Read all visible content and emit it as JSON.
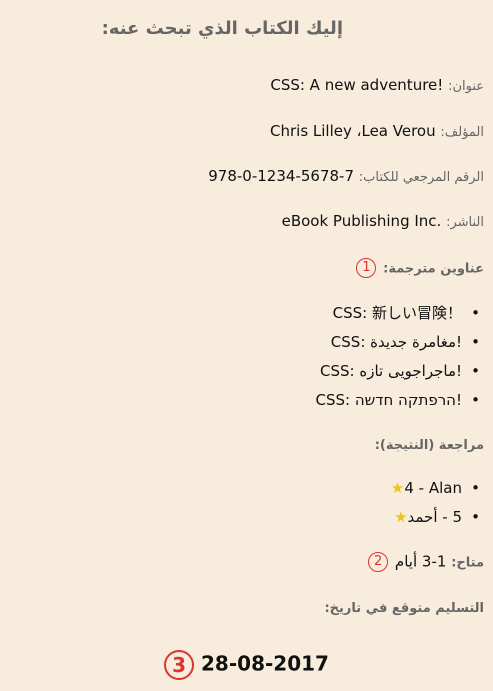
{
  "title": "إليك الكتاب الذي تبحث عنه:",
  "fields": {
    "book_title_label": "عنوان:",
    "book_title_value": "CSS: A new adventure!",
    "author_label": "المؤلف:",
    "author_value": "Chris Lilley ،Lea Verou",
    "isbn_label": "الرقم المرجعي للكتاب:",
    "isbn_value": "978-0-1234-5678-7",
    "publisher_label": "الناشر:",
    "publisher_value": "eBook Publishing Inc."
  },
  "translated": {
    "label": "عناوين مترجمة:",
    "marker": "1",
    "items": [
      "CSS: 新しい冒険！",
      "CSS: مغامرة جديدة!",
      "CSS: ماجراجویی تازه!",
      "CSS: הרפתקה חדשה!"
    ]
  },
  "reviews": {
    "label": "مراجعة (النتيجة):",
    "items": [
      {
        "text": "4 - Alan",
        "icon": "star-icon"
      },
      {
        "text": "5 - أحمد",
        "icon": "star-icon"
      }
    ]
  },
  "availability": {
    "label": "متاح:",
    "value": "1-3 أيام",
    "marker": "2"
  },
  "delivery": {
    "label": "التسليم متوقع في تاريخ:",
    "date": "28-08-2017",
    "marker": "3"
  },
  "colors": {
    "background": "#f8ecdd",
    "label": "#666666",
    "marker": "#dd3333",
    "star": "#f0c020"
  }
}
